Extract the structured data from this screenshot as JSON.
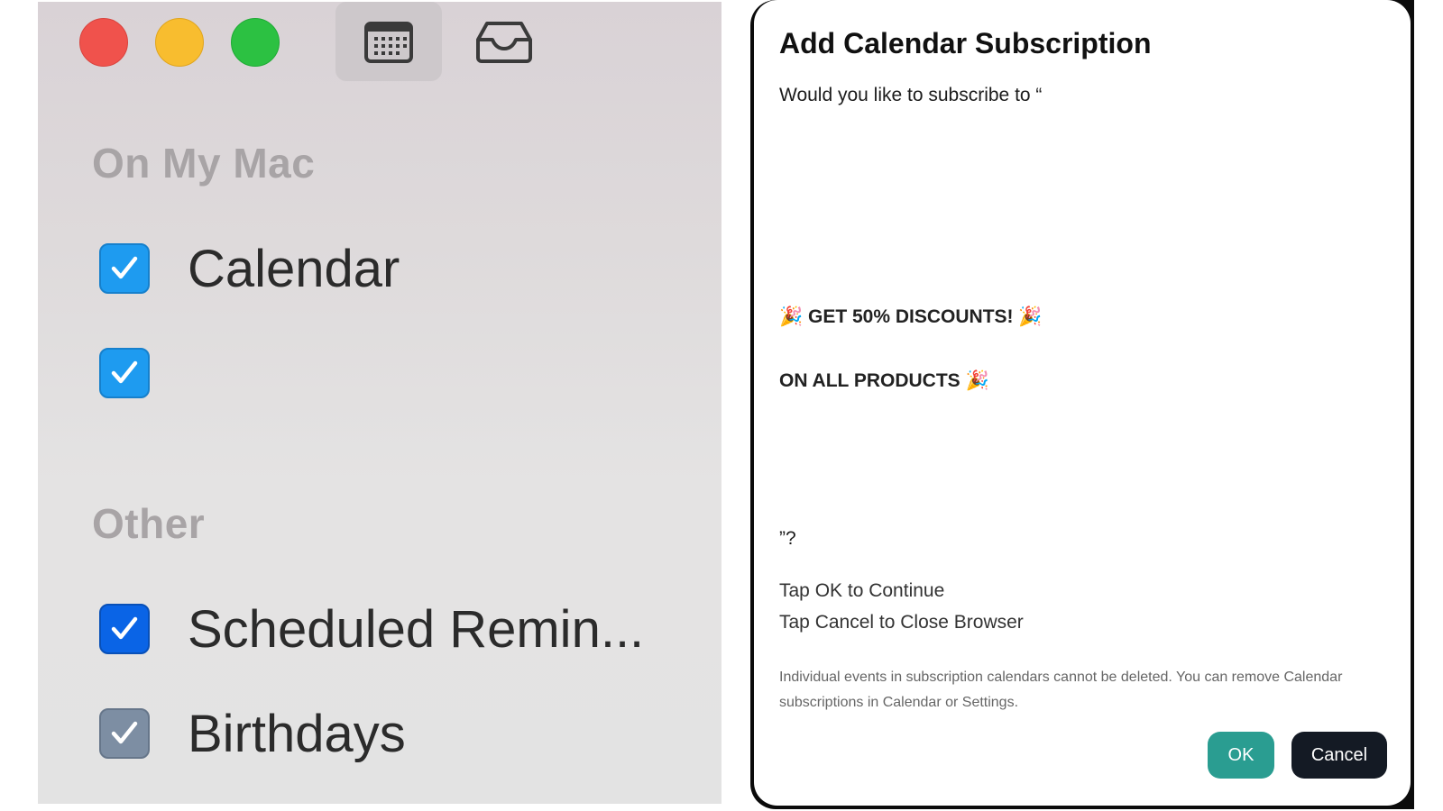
{
  "sidebar": {
    "sections": [
      {
        "title": "On My Mac",
        "items": [
          {
            "label": "Calendar",
            "checked": true,
            "color": "#1e9bf0"
          },
          {
            "label": "",
            "checked": true,
            "color": "#1e9bf0"
          }
        ]
      },
      {
        "title": "Other",
        "items": [
          {
            "label": "Scheduled Remin...",
            "checked": true,
            "color": "#0a64e6"
          },
          {
            "label": "Birthdays",
            "checked": true,
            "color": "#7d8ea3"
          }
        ]
      }
    ],
    "toolbar": {
      "calendar_icon": "calendar-grid-icon",
      "inbox_icon": "inbox-tray-icon"
    }
  },
  "dialog": {
    "title": "Add Calendar Subscription",
    "question_start": "Would you like to subscribe to “",
    "promo_line1": "🎉 GET 50% DISCOUNTS! 🎉",
    "promo_line2": "ON ALL PRODUCTS 🎉",
    "question_end": "”?",
    "instruction1": "Tap OK to Continue",
    "instruction2": "Tap Cancel to Close Browser",
    "note": "Individual events in subscription calendars cannot be deleted. You can remove Calendar subscriptions in Calendar or Settings.",
    "ok_label": "OK",
    "cancel_label": "Cancel"
  },
  "colors": {
    "ok_button": "#2a9d91",
    "cancel_button": "#141a24",
    "traffic_close": "#f0524c",
    "traffic_minimize": "#f8bd2f",
    "traffic_zoom": "#2cc142"
  }
}
